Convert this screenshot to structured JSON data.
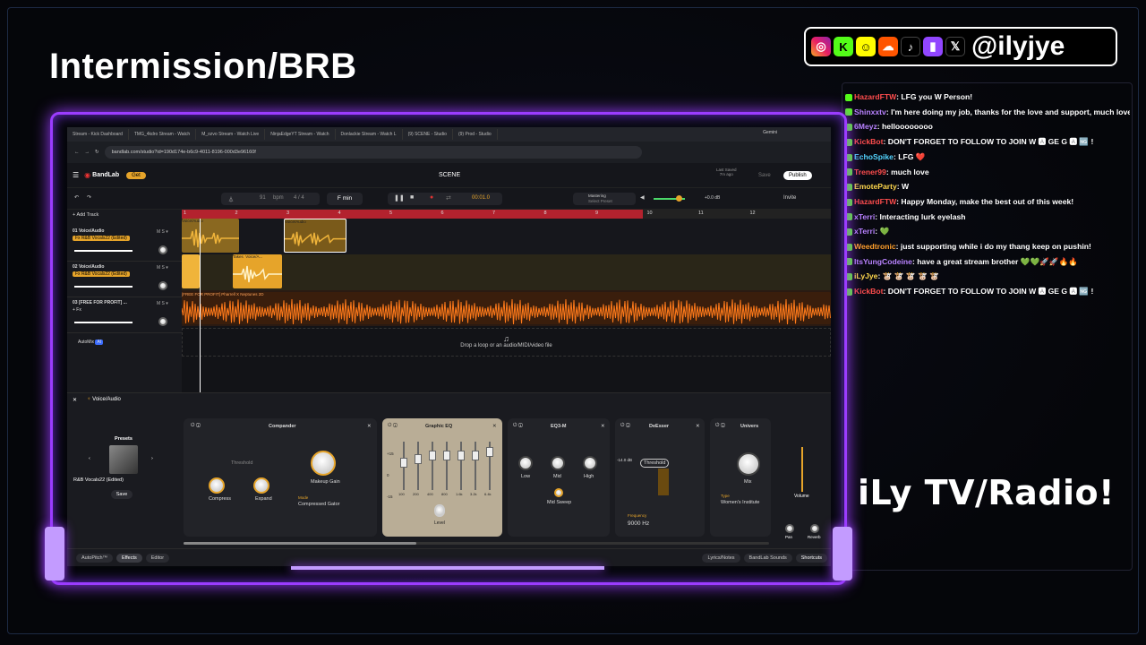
{
  "overlay": {
    "title": "Intermission/BRB",
    "handle": "@ilyjye",
    "tagline": "iLy TV/Radio!"
  },
  "socials": [
    "instagram-icon",
    "kick-icon",
    "snapchat-icon",
    "soundcloud-icon",
    "tiktok-icon",
    "twitch-icon",
    "x-icon"
  ],
  "chat": [
    {
      "user": "HazardFTW",
      "color": "#ff4d4d",
      "msg": "LFG you W Person!"
    },
    {
      "user": "Shinxxtv",
      "color": "#b983ff",
      "msg": "I'm here doing my job, thanks for the love and support, much love from kick FAM"
    },
    {
      "user": "6Meyz",
      "color": "#b983ff",
      "msg": "helloooooooo"
    },
    {
      "user": "KickBot",
      "color": "#ff4d4d",
      "msg": "DON'T FORGET TO FOLLOW TO JOIN W 🅰 GE G 🅰 🆖 !"
    },
    {
      "user": "EchoSpike",
      "color": "#53d4ff",
      "msg": "LFG ❤️"
    },
    {
      "user": "Trener99",
      "color": "#ff4d4d",
      "msg": "much love"
    },
    {
      "user": "EmoteParty",
      "color": "#ffd84d",
      "msg": "W"
    },
    {
      "user": "HazardFTW",
      "color": "#ff4d4d",
      "msg": "Happy Monday, make the best out of this week!"
    },
    {
      "user": "xTerri",
      "color": "#b983ff",
      "msg": "Interacting lurk eyelash"
    },
    {
      "user": "xTerri",
      "color": "#b983ff",
      "msg": "💚"
    },
    {
      "user": "Weedtronic",
      "color": "#ff9f2b",
      "msg": "just supporting while i do my thang keep on pushin!"
    },
    {
      "user": "ItsYungCodeine",
      "color": "#b983ff",
      "msg": "have a great stream brother 💚💚🚀🚀🔥🔥"
    },
    {
      "user": "iLyJye",
      "color": "#ffd84d",
      "msg": "🐮 🐮 🐮 🐮 🐮"
    },
    {
      "user": "KickBot",
      "color": "#ff4d4d",
      "msg": "DON'T FORGET TO FOLLOW TO JOIN W 🅰 GE G 🅰 🆖 !"
    }
  ],
  "browser": {
    "tabs": [
      "Stream - Kick Dashboard",
      "TMG_4kdro Stream - Watch",
      "M_ozvo Stream - Watch Live",
      "NinjaEdgeYT Stream - Watch",
      "Donlackie Stream - Watch L",
      "(9) SCENE - Studio",
      "(9) Prod - Studio"
    ],
    "gemini": "Gemini",
    "url": "bandlab.com/studio?id=190d174e-b6c9-4011-8196-000d3e96160f"
  },
  "app": {
    "brand": "BandLab",
    "get_label": "Get",
    "project": "SCENE",
    "saved_label": "Last Saved",
    "saved_time": "7m ago",
    "save_label": "Save",
    "publish_label": "Publish",
    "invite_label": "Invite"
  },
  "transport": {
    "bpm": "91",
    "bpm_unit": "bpm",
    "timesig": "4 / 4",
    "key": "F min",
    "time": "00:01.0",
    "mastering": "Mastering",
    "preset": "Select Preset",
    "volume_db": "+0.0 dB"
  },
  "ruler": [
    "1",
    "2",
    "3",
    "4",
    "5",
    "6",
    "7",
    "8",
    "9",
    "10",
    "11",
    "12"
  ],
  "tracks": [
    {
      "name": "01 Voice/Audio",
      "fx": "Fx R&B Vocals22 (Edited)",
      "regions": [
        "Voice/Audio",
        "Voice/Audio"
      ]
    },
    {
      "name": "02 Voice/Audio",
      "fx": "Fx R&B Vocals22 (Edited)",
      "regions": [
        "Takes",
        "Voice/A..."
      ]
    },
    {
      "name": "03 [FREE FOR PROFIT] ...",
      "fx": "+ Fx",
      "regions": [
        "[FREE FOR PROFIT] Pharrell X Neptunes 2D"
      ]
    }
  ],
  "add_track": "Add Track",
  "automix": "AutoMix",
  "drop_hint": "Drop a loop or an audio/MIDI/video file",
  "fx": {
    "header": "Voice/Audio",
    "presets_label": "Presets",
    "preset_name": "R&B Vocals22 (Edited)",
    "save_label": "Save",
    "compander": {
      "title": "Compander",
      "threshold": "Threshold",
      "compress": "Compress",
      "expand": "Expand",
      "makeup": "Makeup Gain",
      "mode_label": "Mode",
      "mode": "Compressed Gator"
    },
    "geq": {
      "title": "Graphic EQ",
      "scale": [
        "+15",
        "0",
        "-15"
      ],
      "bands": [
        "100",
        "200",
        "400",
        "800",
        "1.6k",
        "3.2k",
        "6.4k"
      ],
      "level": "Level"
    },
    "eq3": {
      "title": "EQ3-M",
      "low": "Low",
      "mid": "Mid",
      "high": "High",
      "sweep": "Mid Sweep"
    },
    "deesser": {
      "title": "DeEsser",
      "db": "-14.0 dB",
      "threshold": "Threshold",
      "freq_label": "Frequency",
      "freq": "9000 Hz"
    },
    "universe": {
      "title": "Univers",
      "mix": "Mix",
      "type_label": "Type",
      "type": "Women's Institute"
    },
    "volume": "Volume",
    "pan": "Pan",
    "reverb": "Reverb"
  },
  "footer": {
    "autopitch": "AutoPitch™",
    "effects": "Effects",
    "editor": "Editor",
    "lyrics": "Lyrics/Notes",
    "sounds": "BandLab Sounds",
    "shortcuts": "Shortcuts"
  },
  "colors": {
    "neon": "#9b3cff",
    "accent": "#e6a42a",
    "playhead": "#b3222e",
    "waveform": "#ff7a1a",
    "vocal": "#f0b43a"
  }
}
